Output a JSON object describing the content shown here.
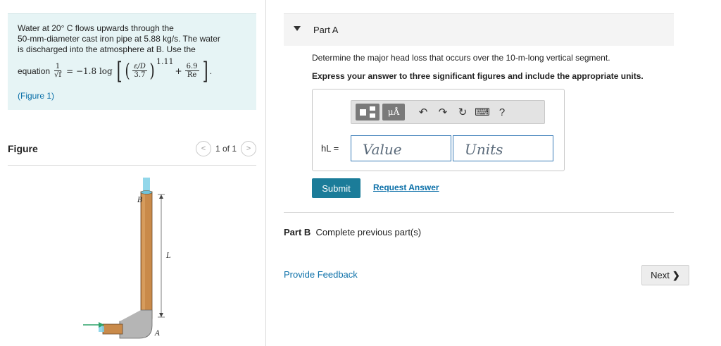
{
  "problem": {
    "line1": "Water at 20° C flows upwards through the",
    "line2": "50-mm-diameter cast iron pipe at 5.88 kg/s. The water",
    "line3": "is discharged into the atmosphere at B. Use the",
    "eq_prefix": "equation",
    "eq_lhs_num": "1",
    "eq_lhs_den": "√f",
    "eq_mid": "= −1.8 log",
    "eq_eps_num": "ε/D",
    "eq_eps_den": "3.7",
    "eq_exp": "1.11",
    "eq_plus": "+",
    "eq_re_num": "6.9",
    "eq_re_den": "Re",
    "eq_end": ".",
    "figure_link": "(Figure 1)"
  },
  "figure": {
    "title": "Figure",
    "pager_text": "1 of 1",
    "labels": {
      "b": "B",
      "l": "L",
      "a": "A"
    }
  },
  "partA": {
    "title": "Part A",
    "question": "Determine the major head loss that occurs over the 10-m-long vertical segment.",
    "instruction": "Express your answer to three significant figures and include the appropriate units.",
    "toolbar": {
      "units_symbol": "μÅ",
      "help": "?"
    },
    "var_label": "hL =",
    "value_placeholder": "Value",
    "units_placeholder": "Units",
    "submit": "Submit",
    "request_answer": "Request Answer"
  },
  "partB": {
    "label": "Part B",
    "status": "Complete previous part(s)"
  },
  "footer": {
    "feedback": "Provide Feedback",
    "next": "Next"
  },
  "colors": {
    "problem_bg": "#e6f4f5",
    "submit_bg": "#1b7c99",
    "link": "#0a6fa8",
    "pipe": "#c98a4a"
  }
}
